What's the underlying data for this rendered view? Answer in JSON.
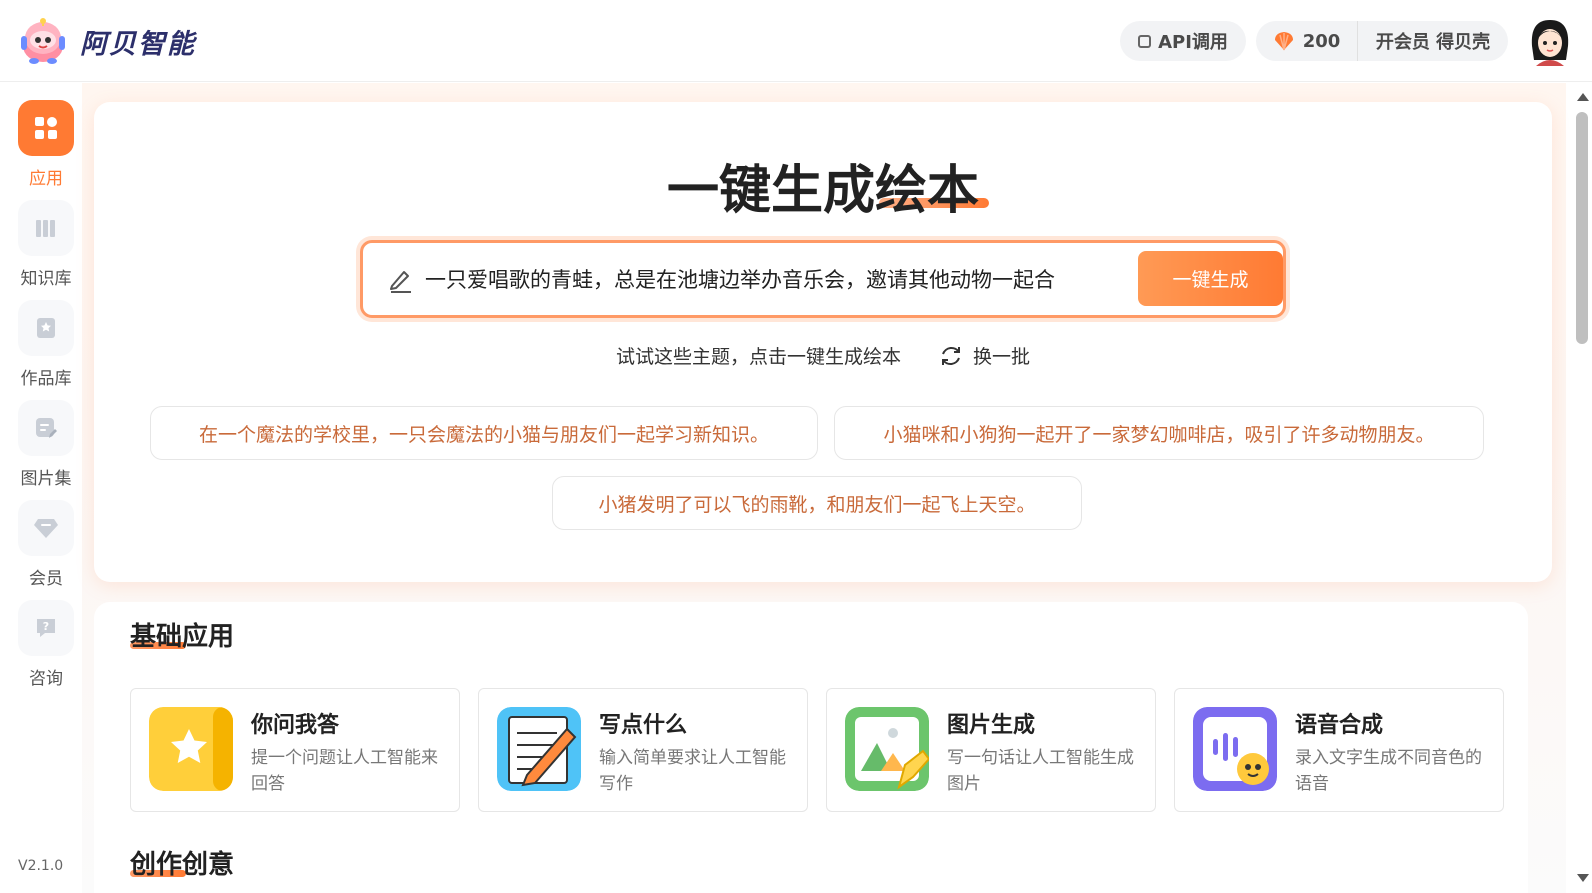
{
  "header": {
    "brand": "阿贝智能",
    "api_label": "API调用",
    "shell_count": "200",
    "vip_label": "开会员 得贝壳"
  },
  "sidebar": {
    "items": [
      {
        "label": "应用",
        "icon": "grid-icon",
        "active": true
      },
      {
        "label": "知识库",
        "icon": "books-icon",
        "active": false
      },
      {
        "label": "作品库",
        "icon": "star-book-icon",
        "active": false
      },
      {
        "label": "图片集",
        "icon": "image-edit-icon",
        "active": false
      },
      {
        "label": "会员",
        "icon": "diamond-icon",
        "active": false
      },
      {
        "label": "咨询",
        "icon": "help-chat-icon",
        "active": false
      }
    ],
    "version": "V2.1.0"
  },
  "hero": {
    "title": "一键生成绘本",
    "prompt_value": "一只爱唱歌的青蛙，总是在池塘边举办音乐会，邀请其他动物一起合",
    "generate_label": "一键生成",
    "try_text": "试试这些主题，点击一键生成绘本",
    "refresh_label": "换一批",
    "suggestions": [
      "在一个魔法的学校里，一只会魔法的小猫与朋友们一起学习新知识。",
      "小猫咪和小狗狗一起开了一家梦幻咖啡店，吸引了许多动物朋友。",
      "小猪发明了可以飞的雨靴，和朋友们一起飞上天空。"
    ]
  },
  "basic_apps": {
    "title": "基础应用",
    "cards": [
      {
        "name": "你问我答",
        "desc": "提一个问题让人工智能来回答",
        "icon": "qa-star-icon"
      },
      {
        "name": "写点什么",
        "desc": "输入简单要求让人工智能写作",
        "icon": "writing-pencil-icon"
      },
      {
        "name": "图片生成",
        "desc": "写一句话让人工智能生成图片",
        "icon": "image-generate-icon"
      },
      {
        "name": "语音合成",
        "desc": "录入文字生成不同音色的语音",
        "icon": "voice-synthesis-icon"
      }
    ]
  },
  "creative": {
    "title": "创作创意"
  },
  "colors": {
    "accent": "#ff7a33",
    "suggestion_text": "#c96a3a",
    "brand_text": "#2c2f6b"
  }
}
